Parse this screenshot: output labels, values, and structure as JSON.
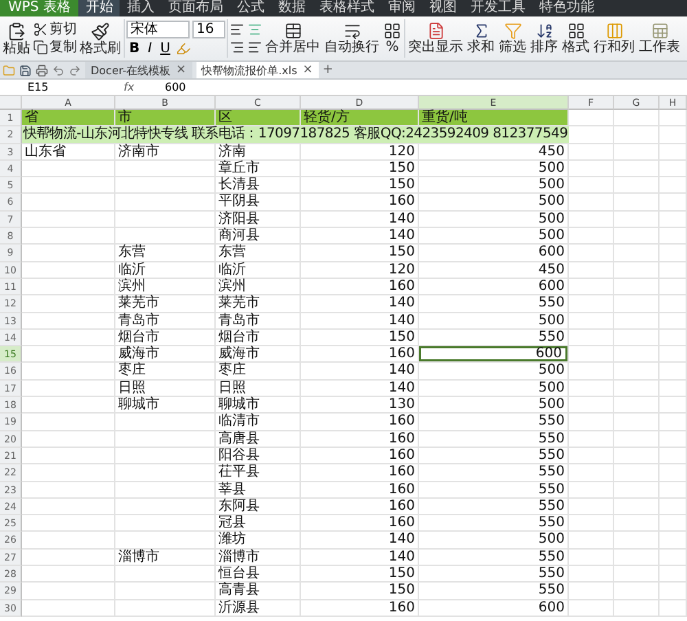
{
  "app": {
    "logo": "WPS 表格"
  },
  "menu": [
    {
      "label": "开始",
      "selected": true
    },
    {
      "label": "插入",
      "selected": false
    },
    {
      "label": "页面布局",
      "selected": false
    },
    {
      "label": "公式",
      "selected": false
    },
    {
      "label": "数据",
      "selected": false
    },
    {
      "label": "表格样式",
      "selected": false
    },
    {
      "label": "审阅",
      "selected": false
    },
    {
      "label": "视图",
      "selected": false
    },
    {
      "label": "开发工具",
      "selected": false
    },
    {
      "label": "特色功能",
      "selected": false
    }
  ],
  "ribbon": {
    "paste": "粘贴",
    "cut": "剪切",
    "copy": "复制",
    "format_painter": "格式刷",
    "font": "宋体",
    "font_size": "16",
    "bold": "B",
    "italic": "I",
    "underline": "U",
    "merge": "合并居中",
    "wrap": "自动换行",
    "number_format": "%",
    "highlight": "突出显示",
    "sum": "求和",
    "filter": "筛选",
    "sort": "排序",
    "format": "格式",
    "rows_cols": "行和列",
    "worksheet": "工作表"
  },
  "doc_tabs": [
    {
      "label": "Docer-在线模板",
      "selected": false,
      "close": "×"
    },
    {
      "label": "快帮物流报价单.xls",
      "selected": true,
      "close": "×"
    }
  ],
  "new_tab": "+",
  "formula_bar": {
    "cell": "E15",
    "fx": "fx",
    "value": "600"
  },
  "columns": [
    {
      "label": "A",
      "selected": false
    },
    {
      "label": "B",
      "selected": false
    },
    {
      "label": "C",
      "selected": false
    },
    {
      "label": "D",
      "selected": false
    },
    {
      "label": "E",
      "selected": true
    },
    {
      "label": "F",
      "selected": false
    },
    {
      "label": "G",
      "selected": false
    },
    {
      "label": "H",
      "selected": false
    }
  ],
  "rows": [
    {
      "n": "1",
      "kind": "header",
      "cells": [
        "省",
        "市",
        "区",
        "轻货/方",
        "重货/吨"
      ],
      "selected": false
    },
    {
      "n": "2",
      "kind": "banner",
      "text": "快帮物流-山东河北特快专线 联系电话：17097187825 客服QQ:2423592409 812377549",
      "selected": false
    },
    {
      "n": "3",
      "kind": "data",
      "province": "山东省",
      "city": "济南市",
      "district": "济南",
      "light": "120",
      "heavy": "450",
      "selected": false
    },
    {
      "n": "4",
      "kind": "data",
      "district": "章丘市",
      "light": "150",
      "heavy": "500",
      "selected": false
    },
    {
      "n": "5",
      "kind": "data",
      "district": "长清县",
      "light": "150",
      "heavy": "500",
      "selected": false
    },
    {
      "n": "6",
      "kind": "data",
      "district": "平阴县",
      "light": "160",
      "heavy": "500",
      "selected": false
    },
    {
      "n": "7",
      "kind": "data",
      "district": "济阳县",
      "light": "140",
      "heavy": "500",
      "selected": false
    },
    {
      "n": "8",
      "kind": "data",
      "district": "商河县",
      "light": "140",
      "heavy": "500",
      "selected": false
    },
    {
      "n": "9",
      "kind": "data",
      "city": "东营",
      "district": "东营",
      "light": "150",
      "heavy": "600",
      "selected": false
    },
    {
      "n": "10",
      "kind": "data",
      "city": "临沂",
      "district": "临沂",
      "light": "120",
      "heavy": "450",
      "selected": false
    },
    {
      "n": "11",
      "kind": "data",
      "city": "滨州",
      "district": "滨州",
      "light": "160",
      "heavy": "600",
      "selected": false
    },
    {
      "n": "12",
      "kind": "data",
      "city": "莱芜市",
      "district": "莱芜市",
      "light": "140",
      "heavy": "550",
      "selected": false
    },
    {
      "n": "13",
      "kind": "data",
      "city": "青岛市",
      "district": "青岛市",
      "light": "140",
      "heavy": "500",
      "selected": false
    },
    {
      "n": "14",
      "kind": "data",
      "city": "烟台市",
      "district": "烟台市",
      "light": "150",
      "heavy": "550",
      "selected": false
    },
    {
      "n": "15",
      "kind": "data",
      "city": "威海市",
      "district": "威海市",
      "light": "160",
      "heavy": "600",
      "selected": true
    },
    {
      "n": "16",
      "kind": "data",
      "city": "枣庄",
      "district": "枣庄",
      "light": "140",
      "heavy": "500",
      "selected": false
    },
    {
      "n": "17",
      "kind": "data",
      "city": "日照",
      "district": "日照",
      "light": "140",
      "heavy": "500",
      "selected": false
    },
    {
      "n": "18",
      "kind": "data",
      "city": "聊城市",
      "district": "聊城市",
      "light": "130",
      "heavy": "500",
      "selected": false
    },
    {
      "n": "19",
      "kind": "data",
      "district": "临清市",
      "light": "160",
      "heavy": "550",
      "selected": false
    },
    {
      "n": "20",
      "kind": "data",
      "district": "高唐县",
      "light": "160",
      "heavy": "550",
      "selected": false
    },
    {
      "n": "21",
      "kind": "data",
      "district": "阳谷县",
      "light": "160",
      "heavy": "550",
      "selected": false
    },
    {
      "n": "22",
      "kind": "data",
      "district": "茌平县",
      "light": "160",
      "heavy": "550",
      "selected": false
    },
    {
      "n": "23",
      "kind": "data",
      "district": "莘县",
      "light": "160",
      "heavy": "550",
      "selected": false
    },
    {
      "n": "24",
      "kind": "data",
      "district": "东阿县",
      "light": "160",
      "heavy": "550",
      "selected": false
    },
    {
      "n": "25",
      "kind": "data",
      "district": "冠县",
      "light": "160",
      "heavy": "550",
      "selected": false
    },
    {
      "n": "26",
      "kind": "data",
      "district": "潍坊",
      "light": "140",
      "heavy": "500",
      "selected": false
    },
    {
      "n": "27",
      "kind": "data",
      "city": "淄博市",
      "district": "淄博市",
      "light": "140",
      "heavy": "550",
      "selected": false
    },
    {
      "n": "28",
      "kind": "data",
      "district": "恒台县",
      "light": "150",
      "heavy": "550",
      "selected": false
    },
    {
      "n": "29",
      "kind": "data",
      "district": "高青县",
      "light": "150",
      "heavy": "550",
      "selected": false
    },
    {
      "n": "30",
      "kind": "data",
      "district": "沂源县",
      "light": "160",
      "heavy": "600",
      "selected": false
    }
  ]
}
